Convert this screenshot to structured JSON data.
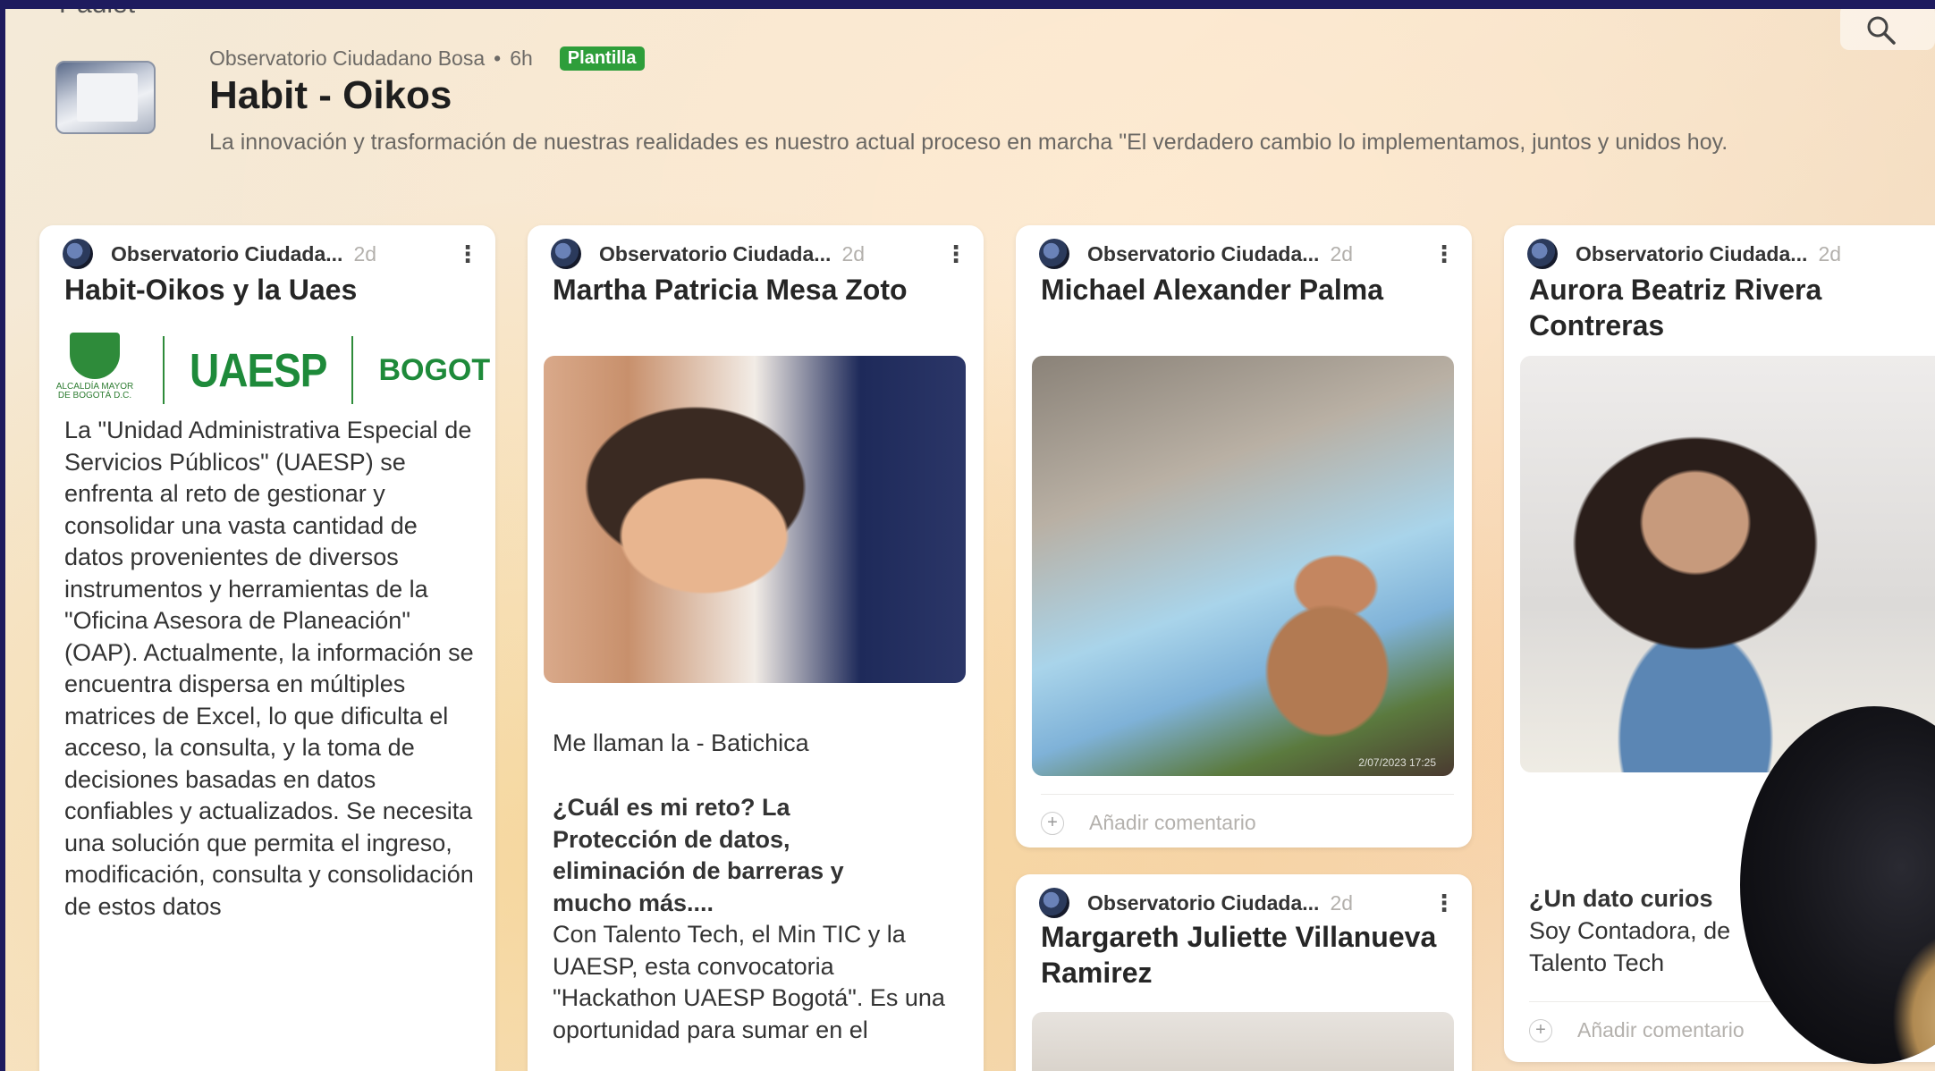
{
  "top_clipped_text": "Padlet",
  "board": {
    "author": "Observatorio Ciudadano Bosa",
    "separator": "•",
    "age": "6h",
    "badge": "Plantilla",
    "title": "Habit - Oikos",
    "description": "La innovación y trasformación de nuestras realidades es nuestro actual proceso en marcha \"El verdadero cambio lo implementamos, juntos y unidos hoy."
  },
  "posts": [
    {
      "author": "Observatorio Ciudada...",
      "age": "2d",
      "title": "Habit-Oikos y la Uaes",
      "logos": {
        "left": "ALCALDÍA MAYOR DE BOGOTÁ D.C.",
        "middle": "UAESP",
        "right": "BOGOT"
      },
      "body": "La \"Unidad Administrativa Especial de Servicios Públicos\" (UAESP) se enfrenta al reto de gestionar y consolidar una vasta cantidad de datos provenientes de diversos instrumentos y herramientas de la \"Oficina Asesora de Planeación\" (OAP). Actualmente, la información se encuentra dispersa en múltiples matrices de Excel, lo que dificulta el acceso, la consulta, y la toma de decisiones basadas en datos confiables y actualizados. Se necesita una solución que permita el ingreso, modificación, consulta y consolidación de estos datos"
    },
    {
      "author": "Observatorio Ciudada...",
      "age": "2d",
      "title": "Martha Patricia Mesa Zoto",
      "intro": "Me llaman la - Batichica",
      "bold": "¿Cuál es mi reto? La Protección de datos, eliminación de barreras y mucho más....",
      "body": "Con Talento Tech, el Min TIC y la UAESP, esta convocatoria \"Hackathon UAESP Bogotá\". Es una oportunidad para sumar en el"
    },
    {
      "author": "Observatorio Ciudada...",
      "age": "2d",
      "title": "Michael Alexander Palma",
      "photo_stamp": "2/07/2023 17:25",
      "comment": "Añadir comentario"
    },
    {
      "author": "Observatorio Ciudada...",
      "age": "2d",
      "title": "Margareth Juliette Villanueva Ramirez"
    },
    {
      "author": "Observatorio Ciudada...",
      "age": "2d",
      "title": "Aurora Beatriz Rivera Contreras",
      "bold": "¿Un dato curios",
      "body": "Soy Contadora, de Talento Tech",
      "comment": "Añadir comentario"
    }
  ],
  "colors": {
    "badge": "#2e9e3a",
    "frame": "#1e1b5e"
  }
}
